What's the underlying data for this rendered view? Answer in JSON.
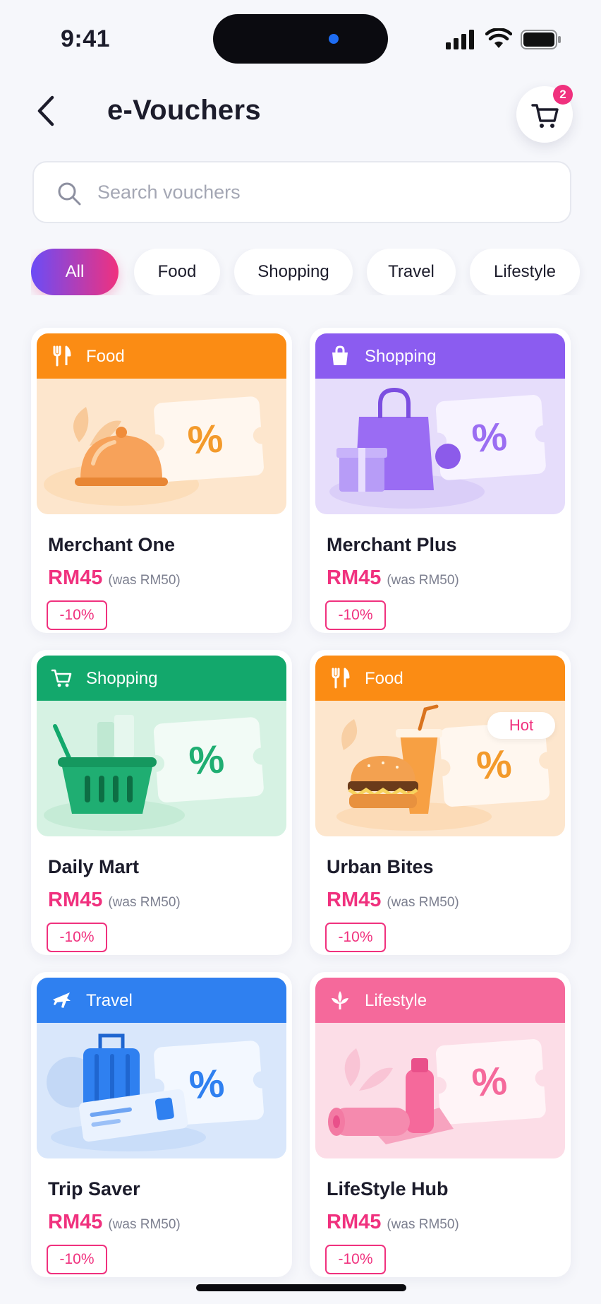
{
  "status_bar": {
    "time": "9:41"
  },
  "header": {
    "title": "e-Vouchers",
    "cart_count": "2"
  },
  "search": {
    "placeholder": "Search vouchers",
    "value": ""
  },
  "filters": [
    {
      "label": "All",
      "active": true
    },
    {
      "label": "Food",
      "active": false
    },
    {
      "label": "Shopping",
      "active": false
    },
    {
      "label": "Travel",
      "active": false
    },
    {
      "label": "Lifestyle",
      "active": false
    }
  ],
  "vouchers": [
    {
      "category": "Food",
      "category_icon": "fork-knife-icon",
      "color": "#fb8c14",
      "bg": "#fde6cd",
      "merchant": "Merchant One",
      "price": "RM45",
      "was": "(was RM50)",
      "discount": "-10%",
      "badge": "",
      "illustration": "food-cloche"
    },
    {
      "category": "Shopping",
      "category_icon": "shopping-bag-icon",
      "color": "#8b5cf0",
      "bg": "#e6ddfb",
      "merchant": "Merchant Plus",
      "price": "RM45",
      "was": "(was RM50)",
      "discount": "-10%",
      "badge": "",
      "illustration": "shopping-bag"
    },
    {
      "category": "Shopping",
      "category_icon": "shopping-cart-icon",
      "color": "#13a86c",
      "bg": "#d6f2e3",
      "merchant": "Daily Mart",
      "price": "RM45",
      "was": "(was RM50)",
      "discount": "-10%",
      "badge": "",
      "illustration": "basket"
    },
    {
      "category": "Food",
      "category_icon": "fork-knife-icon",
      "color": "#fb8c14",
      "bg": "#fde6cd",
      "merchant": "Urban Bites",
      "price": "RM45",
      "was": "(was RM50)",
      "discount": "-10%",
      "badge": "Hot",
      "illustration": "burger-drink"
    },
    {
      "category": "Travel",
      "category_icon": "airplane-icon",
      "color": "#2f80f0",
      "bg": "#d9e7fb",
      "merchant": "Trip Saver",
      "price": "RM45",
      "was": "(was RM50)",
      "discount": "-10%",
      "badge": "",
      "illustration": "luggage"
    },
    {
      "category": "Lifestyle",
      "category_icon": "lotus-icon",
      "color": "#f5699b",
      "bg": "#fcdde7",
      "merchant": "LifeStyle Hub",
      "price": "RM45",
      "was": "(was RM50)",
      "discount": "-10%",
      "badge": "",
      "illustration": "yoga-mat"
    }
  ]
}
